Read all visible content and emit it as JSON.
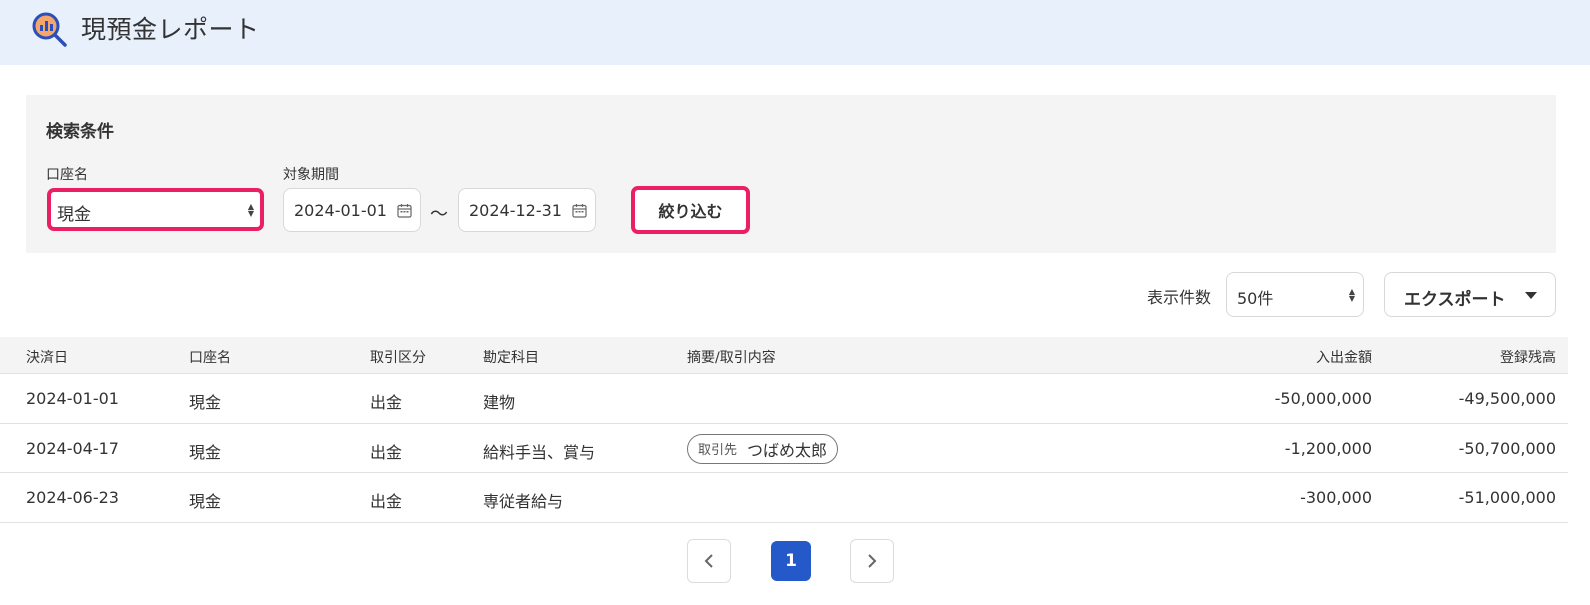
{
  "header": {
    "title": "現預金レポート",
    "icon": "report-search-icon"
  },
  "search": {
    "title": "検索条件",
    "account_label": "口座名",
    "account_value": "現金",
    "period_label": "対象期間",
    "date_from": "2024-01-01",
    "date_to": "2024-12-31",
    "range_separator": "～",
    "filter_button": "絞り込む"
  },
  "toolbar": {
    "per_page_label": "表示件数",
    "per_page_value": "50件",
    "export_label": "エクスポート"
  },
  "table": {
    "headers": {
      "date": "決済日",
      "account": "口座名",
      "type": "取引区分",
      "item": "勘定科目",
      "desc": "摘要/取引内容",
      "amount": "入出金額",
      "balance": "登録残高"
    },
    "rows": [
      {
        "date": "2024-01-01",
        "account": "現金",
        "type": "出金",
        "item": "建物",
        "partner_key": "",
        "partner_value": "",
        "amount": "-50,000,000",
        "balance": "-49,500,000"
      },
      {
        "date": "2024-04-17",
        "account": "現金",
        "type": "出金",
        "item": "給料手当、賞与",
        "partner_key": "取引先",
        "partner_value": "つばめ太郎",
        "amount": "-1,200,000",
        "balance": "-50,700,000"
      },
      {
        "date": "2024-06-23",
        "account": "現金",
        "type": "出金",
        "item": "専従者給与",
        "partner_key": "",
        "partner_value": "",
        "amount": "-300,000",
        "balance": "-51,000,000"
      }
    ]
  },
  "pagination": {
    "current": "1"
  },
  "colors": {
    "header_bg": "#e8f0fc",
    "highlight": "#ec1f66",
    "pager_active": "#2558c9",
    "panel_bg": "#f5f4f4"
  }
}
